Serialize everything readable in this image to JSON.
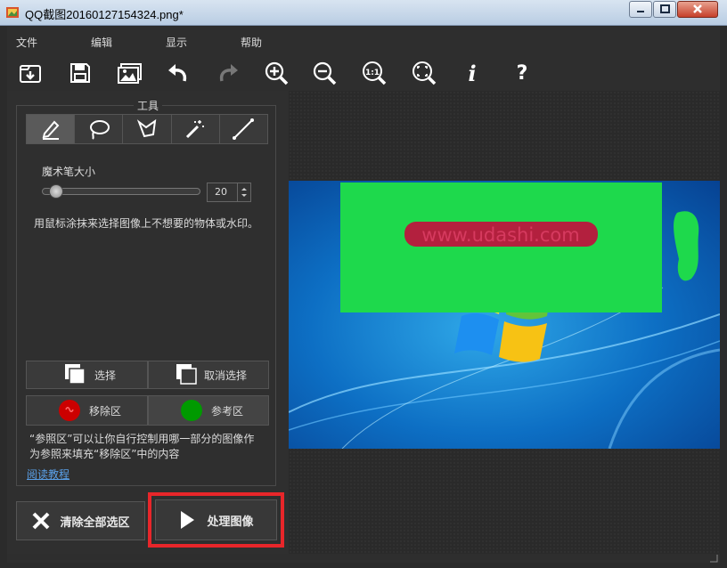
{
  "window": {
    "title": "QQ截图20160127154324.png*"
  },
  "menu": {
    "items": [
      "文件",
      "编辑",
      "显示",
      "帮助"
    ]
  },
  "toolbar": {
    "icons": [
      "open-icon",
      "save-icon",
      "image-icon",
      "undo-icon",
      "redo-icon",
      "zoom-in-icon",
      "zoom-out-icon",
      "zoom-1to1-icon",
      "fit-icon",
      "info-icon",
      "help-icon"
    ],
    "zoom_1to1_label": "1:1",
    "info_label": "i",
    "help_label": "?"
  },
  "tools": {
    "group_title": "工具",
    "items": [
      "pencil-icon",
      "lasso-icon",
      "polygon-lasso-icon",
      "magic-wand-icon",
      "line-icon"
    ],
    "brush_size_label": "魔术笔大小",
    "brush_size_value": "20",
    "brush_size_fraction": 0.05,
    "hint": "用鼠标涂抹来选择图像上不想要的物体或水印。"
  },
  "selection": {
    "select_label": "选择",
    "deselect_label": "取消选择"
  },
  "regions": {
    "remove_label": "移除区",
    "reference_label": "参考区",
    "remove_color": "#cc0000",
    "reference_color": "#009a00",
    "desc_line1": "“参照区”可以让你自行控制用哪一部分的图像作",
    "desc_line2": "为参照来填充“移除区”中的内容",
    "tutorial_link": "阅读教程"
  },
  "actions": {
    "clear_label": "清除全部选区",
    "process_label": "处理图像"
  },
  "image": {
    "watermark_text": "www.udashi.com",
    "overlay_color": "#1ed94c",
    "mark_color": "#b3203e"
  }
}
